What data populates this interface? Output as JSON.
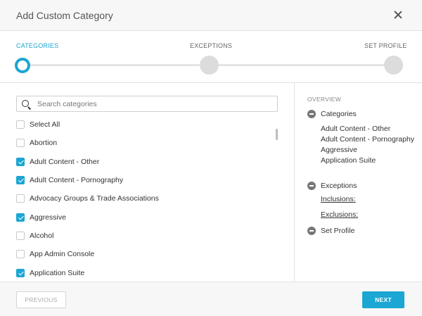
{
  "dialog": {
    "title": "Add Custom Category"
  },
  "steps": [
    {
      "label": "CATEGORIES",
      "active": true
    },
    {
      "label": "EXCEPTIONS",
      "active": false
    },
    {
      "label": "SET PROFILE",
      "active": false
    }
  ],
  "search": {
    "placeholder": "Search categories",
    "value": ""
  },
  "categories": [
    {
      "label": "Select All",
      "checked": false
    },
    {
      "label": "Abortion",
      "checked": false
    },
    {
      "label": "Adult Content - Other",
      "checked": true
    },
    {
      "label": "Adult Content - Pornography",
      "checked": true
    },
    {
      "label": "Advocacy Groups & Trade Associations",
      "checked": false
    },
    {
      "label": "Aggressive",
      "checked": true
    },
    {
      "label": "Alcohol",
      "checked": false
    },
    {
      "label": "App Admin Console",
      "checked": false
    },
    {
      "label": "Application Suite",
      "checked": true
    }
  ],
  "overview": {
    "title": "OVERVIEW",
    "categories_label": "Categories",
    "selected": [
      "Adult Content - Other",
      "Adult Content - Pornography",
      "Aggressive",
      "Application Suite"
    ],
    "exceptions_label": "Exceptions",
    "inclusions_label": "Inclusions:",
    "exclusions_label": "Exclusions:",
    "set_profile_label": "Set Profile"
  },
  "footer": {
    "previous_label": "PREVIOUS",
    "next_label": "NEXT"
  },
  "colors": {
    "accent": "#1ba6d3",
    "muted": "#dcdcdc",
    "icon": "#777777"
  }
}
